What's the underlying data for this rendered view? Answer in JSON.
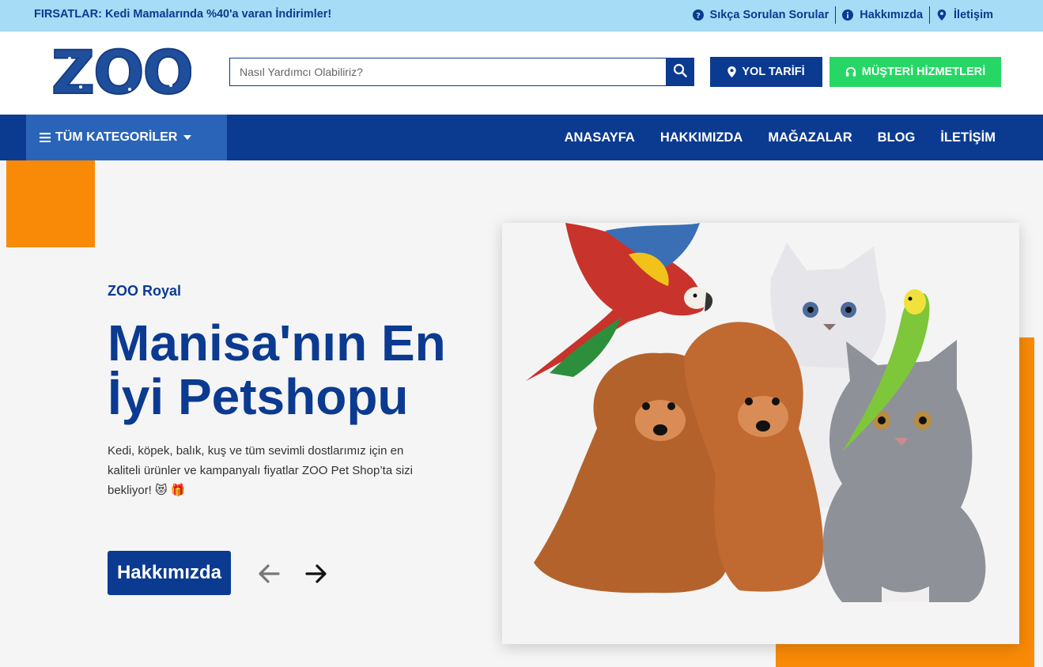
{
  "topbar": {
    "promo_label": "FIRSATLAR:",
    "promo_text": "Kedi Mamalarında %40'a varan İndirimler!",
    "links": [
      {
        "label": "Sıkça Sorulan Sorular",
        "icon": "question-circle-icon"
      },
      {
        "label": "Hakkımızda",
        "icon": "info-circle-icon"
      },
      {
        "label": "İletişim",
        "icon": "map-pin-icon"
      }
    ]
  },
  "header": {
    "logo_text": "ZOO",
    "search_placeholder": "Nasıl Yardımcı Olabiliriz?",
    "search_value": "",
    "directions_label": "YOL TARİFİ",
    "customer_service_label": "MÜŞTERİ HİZMETLERİ"
  },
  "nav": {
    "categories_label": "TÜM KATEGORİLER",
    "links": [
      "ANASAYFA",
      "HAKKIMIZDA",
      "MAĞAZALAR",
      "BLOG",
      "İLETİŞİM"
    ]
  },
  "hero": {
    "subtitle": "ZOO Royal",
    "headline": "Manisa'nın En İyi Petshopu",
    "description": "Kedi, köpek, balık, kuş ve tüm sevimli dostlarımız için en kaliteli ürünler ve kampanyalı fiyatlar ZOO Pet Shop’ta sizi bekliyor! 😻 🎁",
    "button_label": "Hakkımızda"
  },
  "colors": {
    "brand_blue": "#0b3a91",
    "topbar_bg": "#a6dcf5",
    "accent_orange": "#f98a07",
    "green": "#27d766",
    "category_blue": "#2a64b8"
  }
}
